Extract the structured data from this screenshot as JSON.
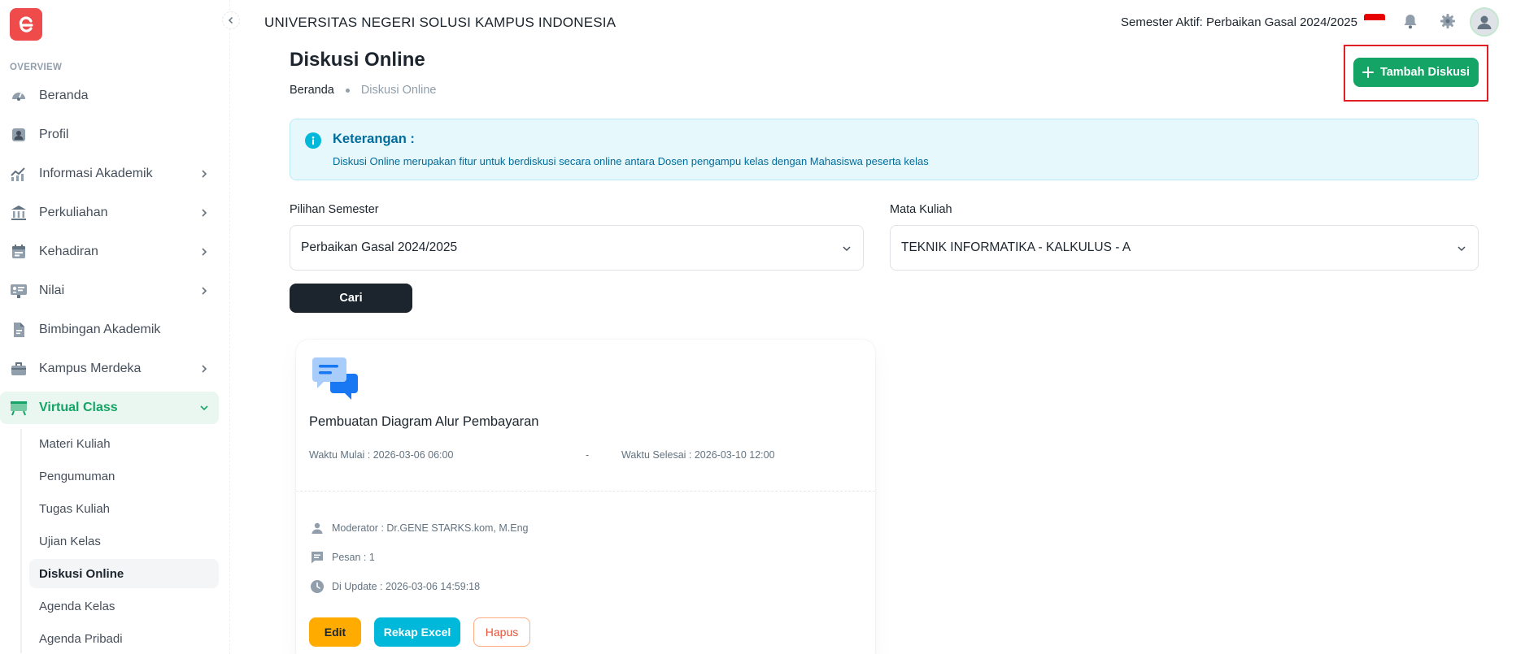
{
  "sidebar": {
    "section_label": "OVERVIEW",
    "items": [
      {
        "label": "Beranda"
      },
      {
        "label": "Profil"
      },
      {
        "label": "Informasi Akademik"
      },
      {
        "label": "Perkuliahan"
      },
      {
        "label": "Kehadiran"
      },
      {
        "label": "Nilai"
      },
      {
        "label": "Bimbingan Akademik"
      },
      {
        "label": "Kampus Merdeka"
      },
      {
        "label": "Virtual Class"
      }
    ],
    "sub_items": [
      {
        "label": "Materi Kuliah"
      },
      {
        "label": "Pengumuman"
      },
      {
        "label": "Tugas Kuliah"
      },
      {
        "label": "Ujian Kelas"
      },
      {
        "label": "Diskusi Online"
      },
      {
        "label": "Agenda Kelas"
      },
      {
        "label": "Agenda Pribadi"
      }
    ]
  },
  "header": {
    "university": "UNIVERSITAS NEGERI SOLUSI KAMPUS INDONESIA",
    "semester": "Semester Aktif: Perbaikan Gasal 2024/2025"
  },
  "page": {
    "title": "Diskusi Online",
    "breadcrumb": [
      "Beranda",
      "Diskusi Online"
    ],
    "add_button": "Tambah Diskusi"
  },
  "info": {
    "title": "Keterangan :",
    "description": "Diskusi Online merupakan fitur untuk berdiskusi secara online antara Dosen pengampu kelas dengan Mahasiswa peserta kelas"
  },
  "filters": {
    "semester_label": "Pilihan Semester",
    "semester_value": "Perbaikan Gasal 2024/2025",
    "course_label": "Mata Kuliah",
    "course_value": "TEKNIK INFORMATIKA - KALKULUS - A",
    "search_button": "Cari"
  },
  "card": {
    "title": "Pembuatan Diagram Alur Pembayaran",
    "start": "Waktu Mulai : 2026-03-06 06:00",
    "separator": "-",
    "end": "Waktu Selesai : 2026-03-10 12:00",
    "moderator": "Moderator : Dr.GENE STARKS.kom, M.Eng",
    "messages": "Pesan : 1",
    "updated": "Di Update : 2026-03-06 14:59:18",
    "edit_button": "Edit",
    "export_button": "Rekap Excel",
    "delete_button": "Hapus"
  },
  "colors": {
    "primary": "#14a465",
    "info": "#00b8d9",
    "warning": "#ffab00",
    "logo": "#ef4b4b",
    "highlight": "#e01e25"
  }
}
